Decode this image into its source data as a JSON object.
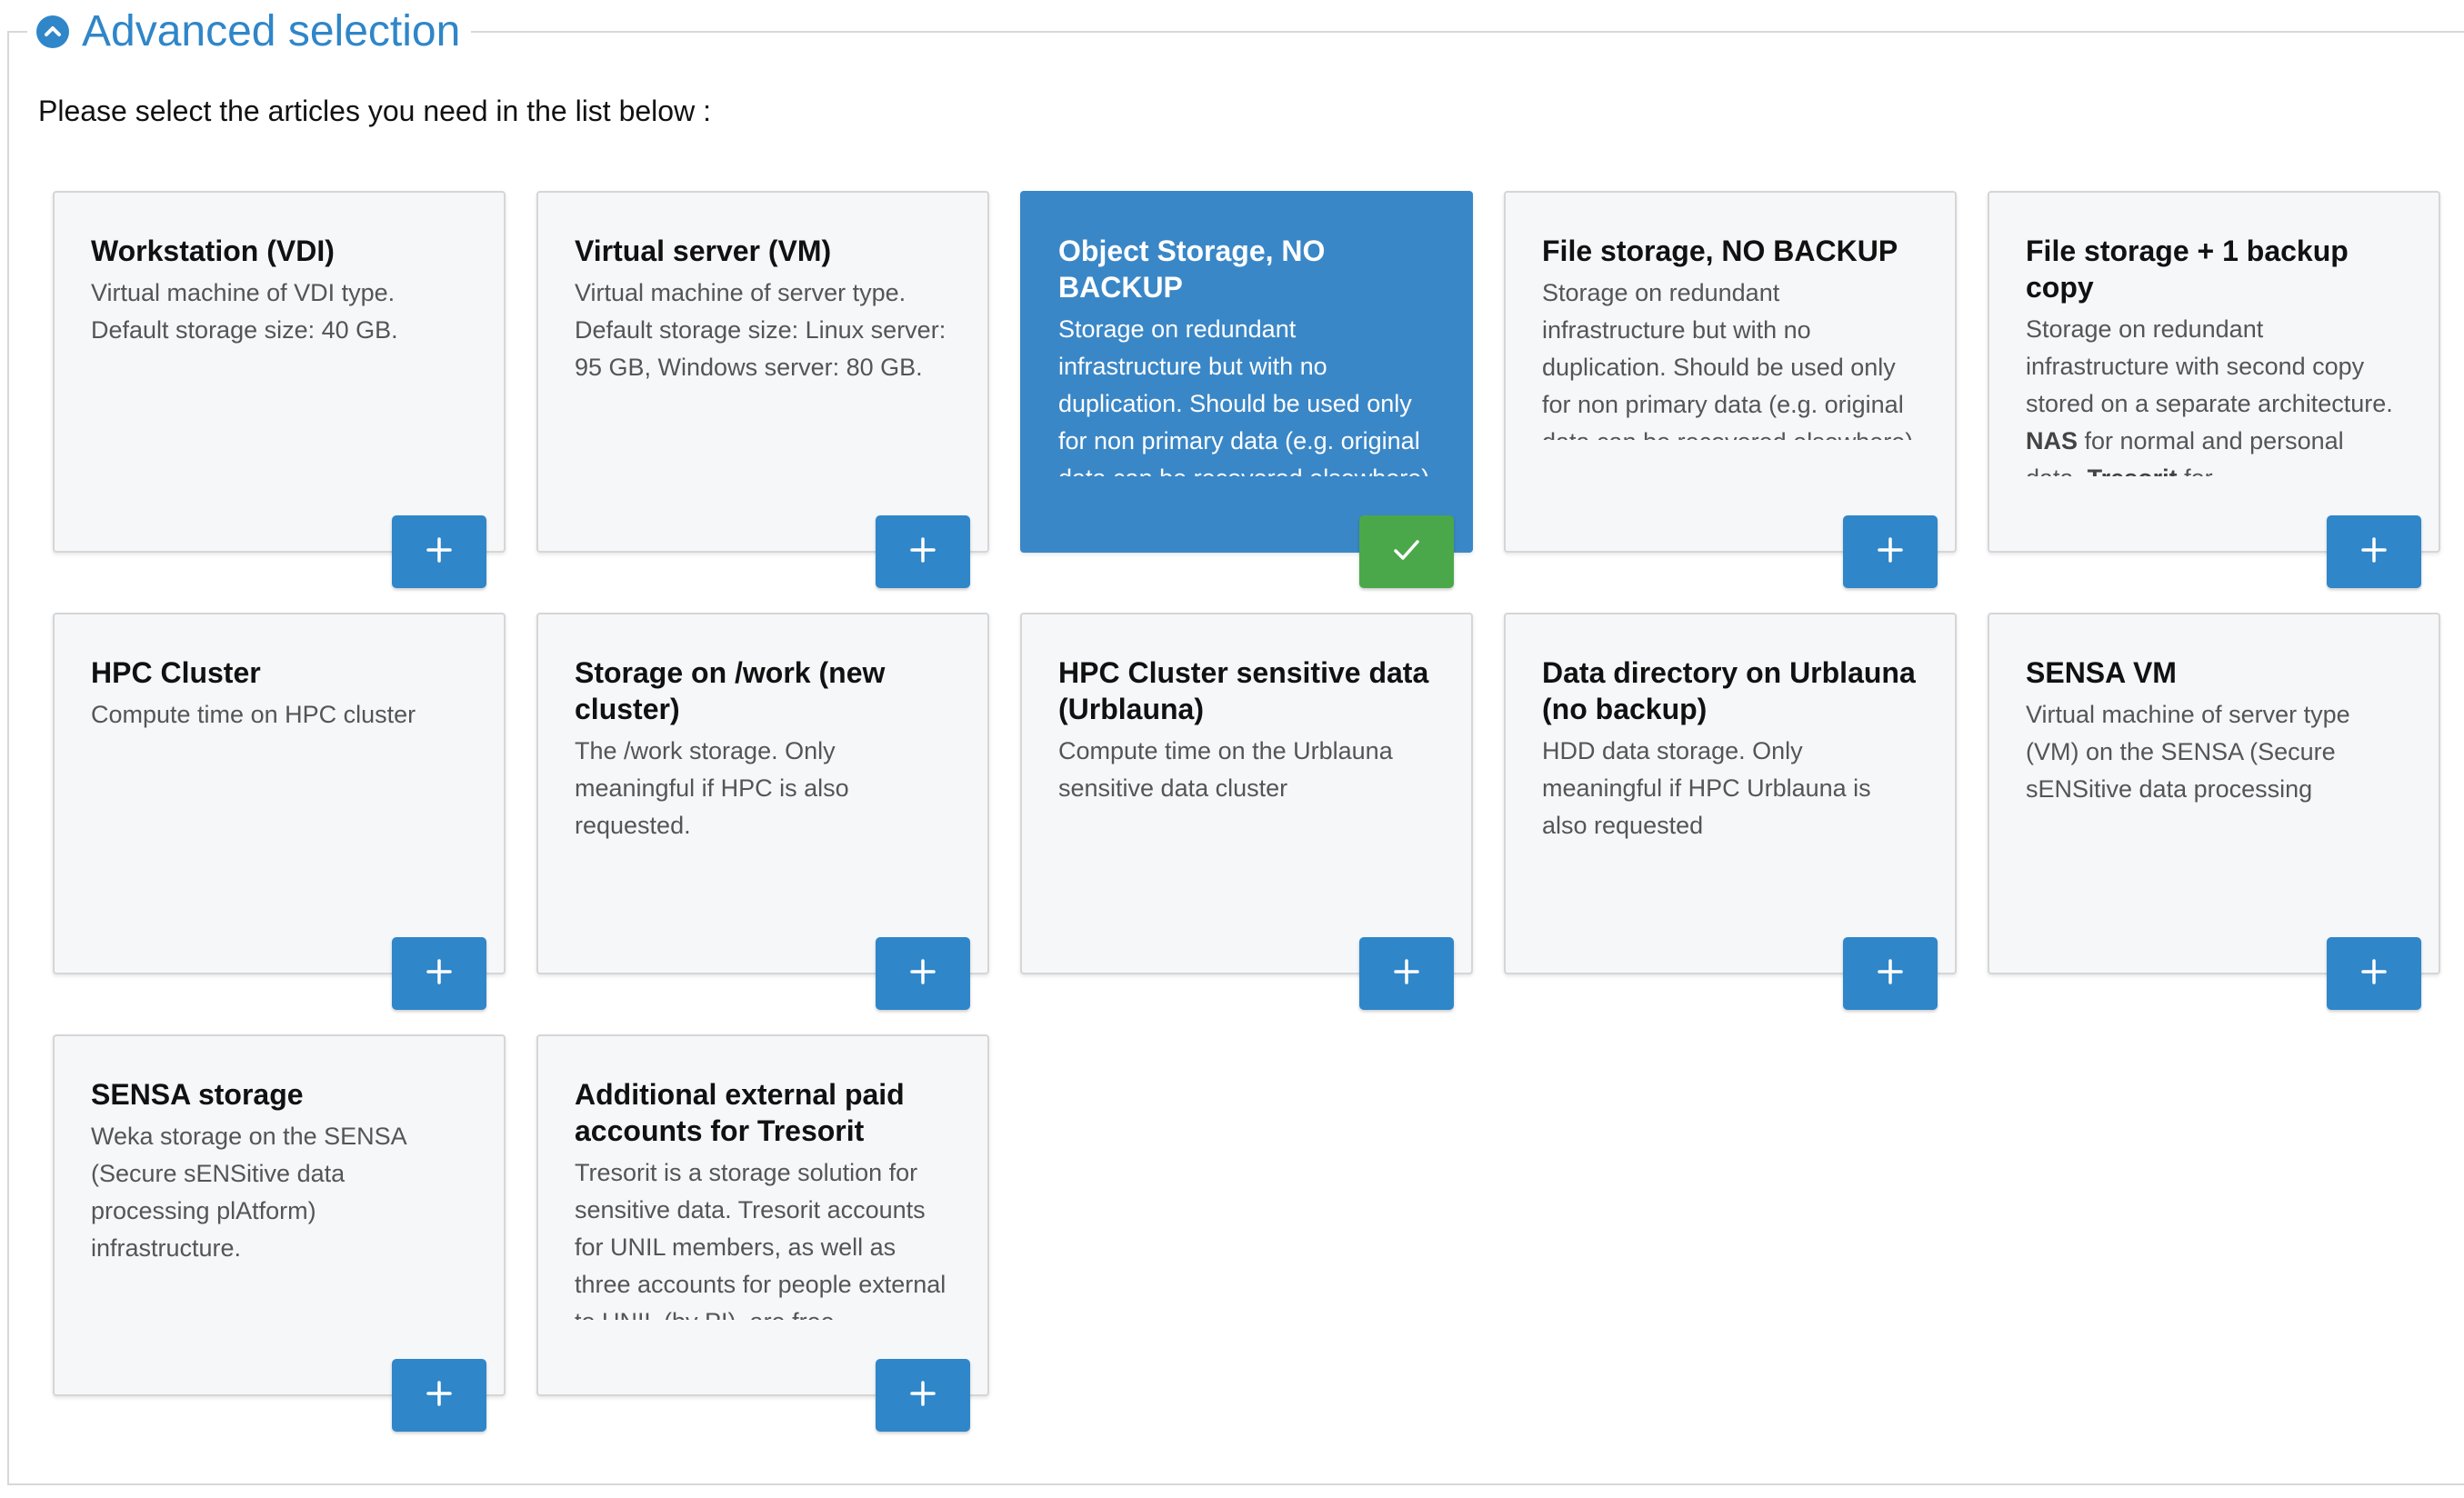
{
  "section": {
    "title": "Advanced selection",
    "instructions": "Please select the articles you need in the list below :"
  },
  "colors": {
    "accent": "#2f86c9",
    "selected_card": "#3a87c7",
    "added_button": "#4aa84a"
  },
  "icons": {
    "legend": "chevron-up-icon",
    "add": "plus-icon",
    "added": "check-icon"
  },
  "articles": [
    {
      "title": "Workstation (VDI)",
      "description": "Virtual machine of VDI type. Default storage size: 40 GB.",
      "selected": false
    },
    {
      "title": "Virtual server (VM)",
      "description": "Virtual machine of server type. Default storage size: Linux server: 95 GB, Windows server: 80 GB.",
      "selected": false
    },
    {
      "title": "Object Storage, NO BACKUP",
      "description": "Storage on redundant infrastructure but with no duplication. Should be used only for non primary data (e.g. original data can be recovered elsewhere)",
      "selected": true
    },
    {
      "title": "File storage, NO BACKUP",
      "description": "Storage on redundant infrastructure but with no duplication. Should be used only for non primary data (e.g. original data can be recovered elsewhere)",
      "selected": false
    },
    {
      "title": "File storage + 1 backup copy",
      "description_parts": [
        {
          "text": "Storage on redundant infrastructure with second copy stored on a separate architecture. ",
          "bold": false
        },
        {
          "text": "NAS",
          "bold": true
        },
        {
          "text": " for normal and personal data, ",
          "bold": false
        },
        {
          "text": "Tresorit",
          "bold": true
        },
        {
          "text": " for",
          "bold": false
        }
      ],
      "selected": false
    },
    {
      "title": "HPC Cluster",
      "description": "Compute time on HPC cluster",
      "selected": false
    },
    {
      "title": "Storage on /work (new cluster)",
      "description": "The /work storage. Only meaningful if HPC is also requested.",
      "selected": false
    },
    {
      "title": "HPC Cluster sensitive data (Urblauna)",
      "description": "Compute time on the Urblauna sensitive data cluster",
      "selected": false
    },
    {
      "title": "Data directory on Urblauna (no backup)",
      "description": "HDD data storage. Only meaningful if HPC Urblauna is also requested",
      "selected": false
    },
    {
      "title": "SENSA VM",
      "description": "Virtual machine of server type (VM) on the SENSA (Secure sENSitive data processing plAtform) infrastructure.",
      "selected": false
    },
    {
      "title": "SENSA storage",
      "description": "Weka storage on the SENSA (Secure sENSitive data processing plAtform) infrastructure.",
      "selected": false
    },
    {
      "title": "Additional external paid accounts for Tresorit",
      "description": "Tresorit is a storage solution for sensitive data. Tresorit accounts for UNIL members, as well as three accounts for people external to UNIL (by PI), are free.",
      "selected": false
    }
  ]
}
